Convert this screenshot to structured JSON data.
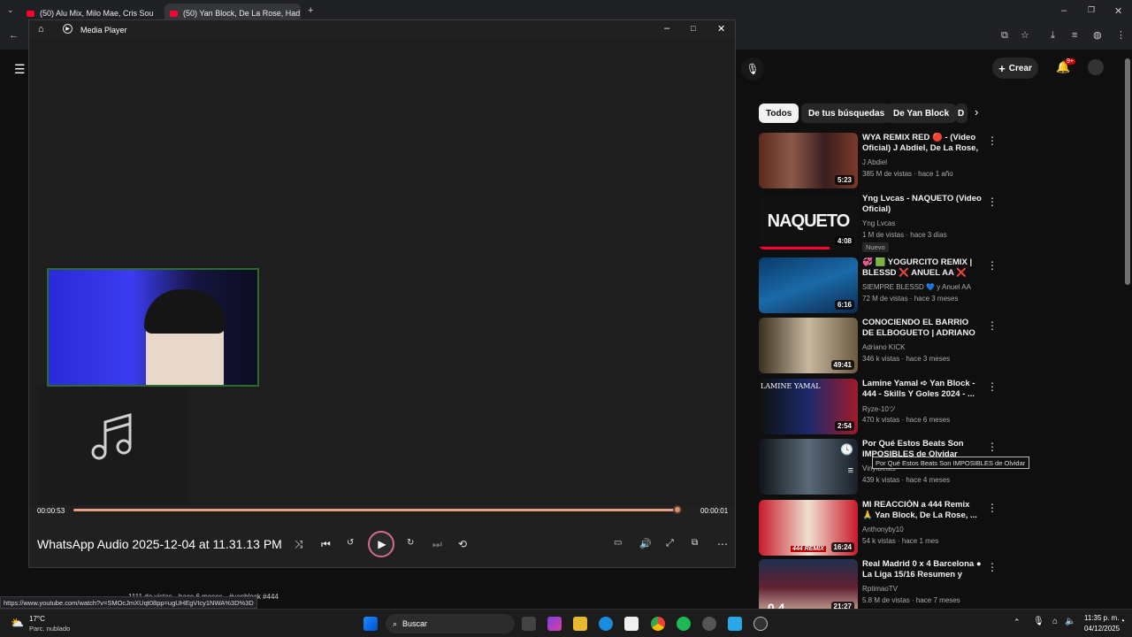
{
  "browser": {
    "tabs": [
      {
        "title": "(50) Alu Mix, Milo Mae, Cris Sou"
      },
      {
        "title": "(50) Yan Block, De La Rose, Had"
      }
    ],
    "status_url": "https://www.youtube.com/watch?v=SMOcJmXUqt08pp=ugUHEgVIcy1NWA%3D%3D"
  },
  "youtube": {
    "create_label": "Crear",
    "notif_count": "9+",
    "chips": [
      "Todos",
      "De tus búsquedas",
      "De Yan Block",
      "D"
    ],
    "videos": [
      {
        "title": "WYA REMIX RED 🔴 - (Video Oficial) J Abdiel, De La Rose, ...",
        "channel": "J Abdiel",
        "meta": "385 M de vistas · hace 1 año",
        "duration": "5:23",
        "badge": ""
      },
      {
        "title": "Yng Lvcas - NAQUETO (Video Oficial)",
        "channel": "Yng Lvcas",
        "meta": "1 M de vistas · hace 3 días",
        "duration": "4:08",
        "badge": "Nuevo"
      },
      {
        "title": "💞 🟩 YOGURCITO REMIX | BLESSD ❌ ANUEL AA ❌ YA...",
        "channel": "SIEMPRE BLESSD 💙 y Anuel AA",
        "meta": "72 M de vistas · hace 3 meses",
        "duration": "6:16",
        "badge": ""
      },
      {
        "title": "CONOCIENDO EL BARRIO DE ELBOGUETO | ADRIANO ...",
        "channel": "Adriano KICK",
        "meta": "346 k vistas · hace 3 meses",
        "duration": "49:41",
        "badge": ""
      },
      {
        "title": "Lamine Yamal ➪ Yan Block - 444 - Skills Y Goles 2024 - ...",
        "channel": "Ryze-10ツ",
        "meta": "470 k vistas · hace 6 meses",
        "duration": "2:54",
        "badge": ""
      },
      {
        "title": "Por Qué Estos Beats Son IMPOSIBLES de Olvidar",
        "channel": "VinylBeats",
        "meta": "439 k vistas · hace 4 meses",
        "duration": "",
        "badge": ""
      },
      {
        "title": "MI REACCIÓN a 444 Remix 🙏 Yan Block, De La Rose, ...",
        "channel": "Anthonyby10",
        "meta": "54 k vistas · hace 1 mes",
        "duration": "16:24",
        "badge": ""
      },
      {
        "title": "Real Madrid 0 x 4 Barcelona ● La Liga 15/16 Resumen y Gole...",
        "channel": "RptimaoTV",
        "meta": "5.8 M de vistas · hace 7 meses",
        "duration": "21:27",
        "badge": ""
      }
    ],
    "thumb_text": {
      "naqueto": "NAQUETO",
      "lamine": "LAMINE YAMAL",
      "remix": "444 REMIX",
      "score": "0 4"
    },
    "tooltip": "Por Qué Estos Beats Son IMPOSIBLES de Olvidar",
    "behind_text": "1111 de vistas · hace 6 meses · #yanblock #444"
  },
  "media_player": {
    "app_name": "Media Player",
    "track_title": "WhatsApp Audio 2025-12-04 at 11.31.13 PM",
    "elapsed": "00:00:53",
    "remaining": "00:00:01",
    "progress": 0.99
  },
  "taskbar": {
    "weather_temp": "17°C",
    "weather_desc": "Parc. nublado",
    "search_label": "Buscar",
    "time": "11:35 p. m.",
    "date": "04/12/2025"
  }
}
